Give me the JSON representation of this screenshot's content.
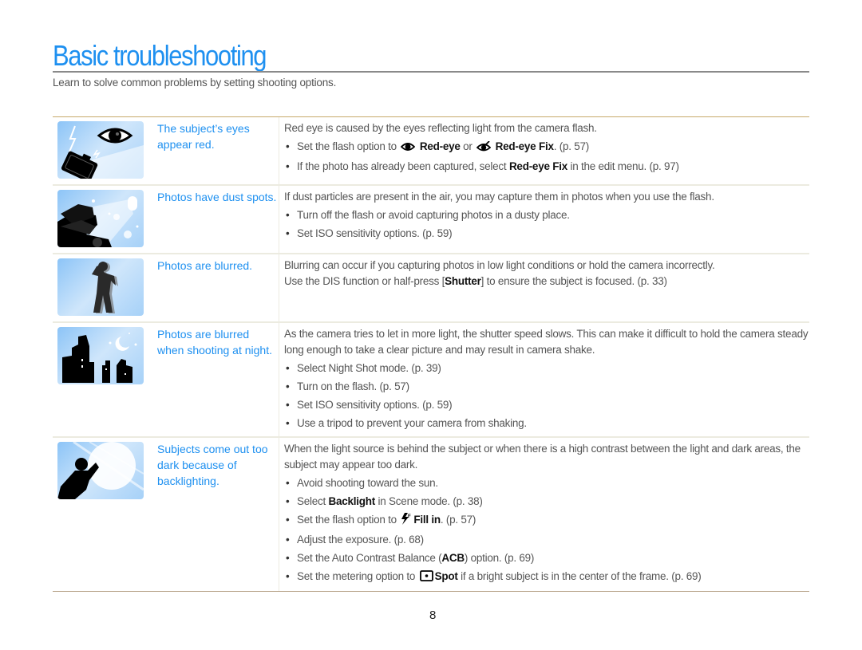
{
  "page": {
    "title": "Basic troubleshooting",
    "intro": "Learn to solve common problems by setting shooting options.",
    "page_number": "8"
  },
  "colors": {
    "accent": "#1e90f0",
    "body_text": "#555555",
    "table_top_rule": "#c8a96b",
    "row_divider": "#ecebe0"
  },
  "rows": [
    {
      "icon": "red-eye-flash-camera-icon",
      "label": "The subject’s eyes appear red.",
      "intro": "Red eye is caused by the eyes reflecting light from the camera flash.",
      "bullets": [
        {
          "pre": "Set the flash option to ",
          "icon1": "red-eye-icon",
          "b1": "Red-eye",
          "mid": " or ",
          "icon2": "red-eye-fix-icon",
          "b2": "Red-eye Fix",
          "post": ". (p. 57)"
        },
        {
          "pre": "If the photo has already been captured, select ",
          "b1": "Red-eye Fix",
          "post": " in the edit menu. (p. 97)"
        }
      ]
    },
    {
      "icon": "dust-spots-icon",
      "label": "Photos have dust spots.",
      "intro": "If dust particles are present in the air, you may capture them in photos when you use the flash.",
      "bullets": [
        {
          "text": "Turn off the flash or avoid capturing photos in a dusty place."
        },
        {
          "text": "Set ISO sensitivity options. (p. 59)"
        }
      ]
    },
    {
      "icon": "blurred-person-icon",
      "label": "Photos are blurred.",
      "intro": "Blurring can occur if you capturing photos in low light conditions or hold the camera incorrectly.",
      "line2_pre": "Use the DIS function or half-press [",
      "line2_b": "Shutter",
      "line2_post": "] to ensure the subject is focused. (p. 33)"
    },
    {
      "icon": "night-city-icon",
      "label": "Photos are blurred when shooting at night.",
      "intro": "As the camera tries to let in more light, the shutter speed slows. This can make it difficult to hold the camera steady long enough to take a clear picture and may result in camera shake.",
      "bullets": [
        {
          "text": "Select Night Shot mode. (p. 39)"
        },
        {
          "text": "Turn on the flash. (p. 57)"
        },
        {
          "text": "Set ISO sensitivity options. (p. 59)"
        },
        {
          "text": "Use a tripod to prevent your camera from shaking."
        }
      ]
    },
    {
      "icon": "backlight-person-icon",
      "label": "Subjects come out too dark because of backlighting.",
      "intro": "When the light source is behind the subject or when there is a high contrast between the light and dark areas, the subject may appear too dark.",
      "bullets": [
        {
          "text": "Avoid shooting toward the sun."
        },
        {
          "pre": "Select ",
          "b1": "Backlight",
          "post": " in Scene mode. (p. 38)"
        },
        {
          "pre": "Set the flash option to ",
          "icon1": "fill-in-flash-icon",
          "b1": "Fill in",
          "post": ". (p. 57)"
        },
        {
          "text": "Adjust the exposure. (p. 68)"
        },
        {
          "pre": "Set the Auto Contrast Balance (",
          "b1": "ACB",
          "post": ") option. (p. 69)"
        },
        {
          "pre": "Set the metering option to ",
          "icon1": "spot-metering-icon",
          "b1": "Spot",
          "post": " if a bright subject is in the center of the frame. (p. 69)"
        }
      ]
    }
  ]
}
